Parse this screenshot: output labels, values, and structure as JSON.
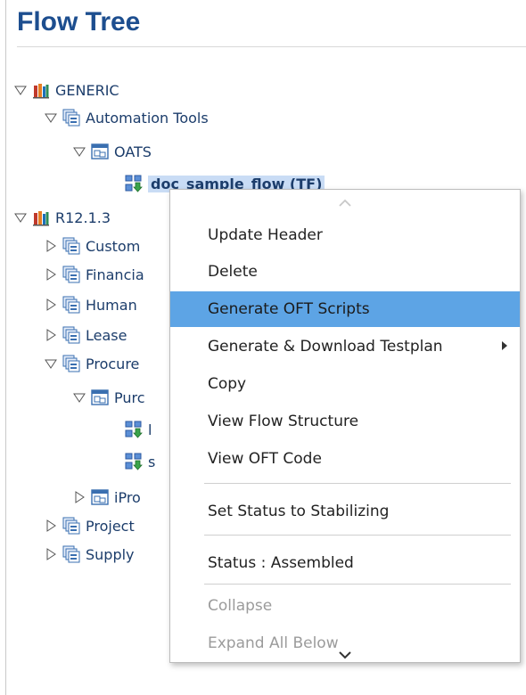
{
  "panel": {
    "title": "Flow Tree"
  },
  "tree": {
    "generic": "GENERIC",
    "automation_tools": "Automation Tools",
    "oats": "OATS",
    "doc_sample_flow": "doc_sample_flow (TF)",
    "r12": "R12.1.3",
    "customer": "Custom",
    "financials": "Financia",
    "human": "Human",
    "lease": "Lease",
    "procurement": "Procure",
    "purchasing": "Purc",
    "flow_a": "l",
    "flow_b": "s",
    "iproc": "iPro",
    "projects": "Project",
    "supply": "Supply"
  },
  "context_menu": {
    "update_header": "Update Header",
    "delete": "Delete",
    "generate_oft": "Generate OFT Scripts",
    "generate_download": "Generate & Download Testplan",
    "copy": "Copy",
    "view_structure": "View Flow Structure",
    "view_code": "View OFT Code",
    "set_status": "Set Status to Stabilizing",
    "status": "Status : Assembled",
    "collapse": "Collapse",
    "expand_all": "Expand All Below",
    "highlight_color": "#5da4e5"
  },
  "icons": {
    "expanded": "triangle-down-icon",
    "collapsed": "triangle-right-icon",
    "library": "library-books-icon",
    "category": "stacked-folders-icon",
    "group": "group-box-icon",
    "flow": "flow-icon"
  }
}
